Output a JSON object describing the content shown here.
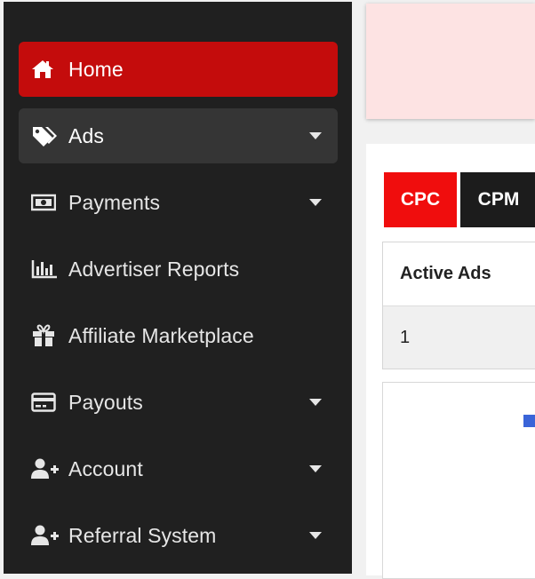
{
  "sidebar": {
    "items": [
      {
        "label": "Home",
        "icon": "home-icon",
        "state": "active",
        "has_caret": false
      },
      {
        "label": "Ads",
        "icon": "tags-icon",
        "state": "hover",
        "has_caret": true
      },
      {
        "label": "Payments",
        "icon": "money-bill-icon",
        "state": "normal",
        "has_caret": true
      },
      {
        "label": "Advertiser Reports",
        "icon": "bar-chart-icon",
        "state": "normal",
        "has_caret": false
      },
      {
        "label": "Affiliate Marketplace",
        "icon": "gift-icon",
        "state": "normal",
        "has_caret": false
      },
      {
        "label": "Payouts",
        "icon": "credit-card-icon",
        "state": "normal",
        "has_caret": true
      },
      {
        "label": "Account",
        "icon": "user-plus-icon",
        "state": "normal",
        "has_caret": true
      },
      {
        "label": "Referral System",
        "icon": "user-plus-icon",
        "state": "normal",
        "has_caret": true
      }
    ]
  },
  "main": {
    "tabs": [
      {
        "label": "CPC",
        "selected": true
      },
      {
        "label": "CPM",
        "selected": false
      }
    ],
    "table": {
      "header": "Active Ads",
      "value": "1"
    }
  },
  "colors": {
    "sidebar_bg": "#202020",
    "active": "#c40c0c",
    "tab_active": "#f00d0d",
    "banner": "#fde3e3",
    "legend": "#3a64d8"
  }
}
